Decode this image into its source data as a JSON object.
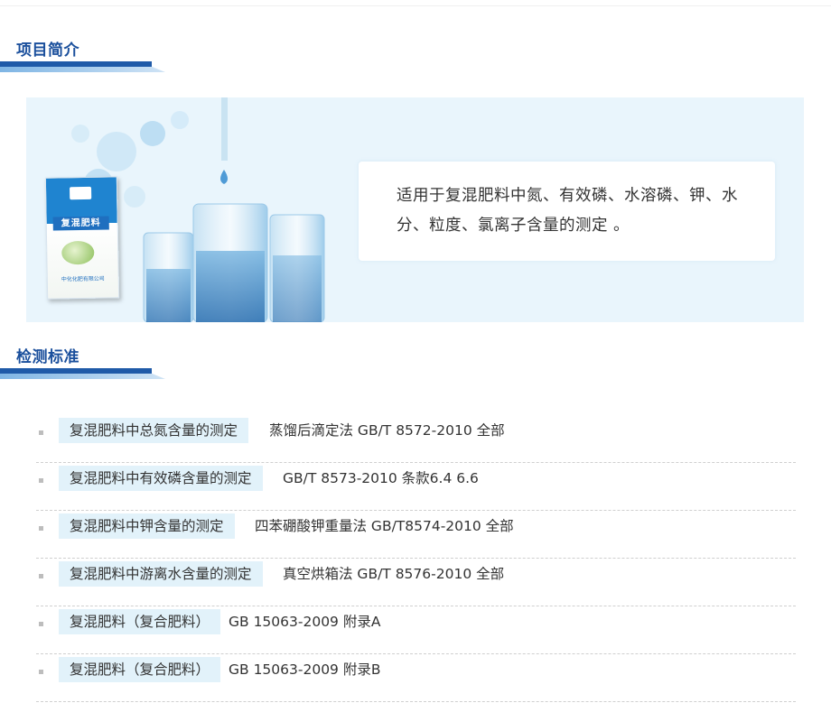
{
  "sections": {
    "intro_title": "项目简介",
    "standards_title": "检测标准"
  },
  "banner": {
    "description": "适用于复混肥料中氮、有效磷、水溶磷、钾、水分、粒度、氯离子含量的测定 。",
    "product_label": "复混肥料",
    "product_company": "中化化肥有限公司"
  },
  "standards": [
    {
      "item": "复混肥料中总氮含量的测定",
      "method": "蒸馏后滴定法 GB/T 8572-2010 全部"
    },
    {
      "item": "复混肥料中有效磷含量的测定",
      "method": "GB/T 8573-2010 条款6.4 6.6"
    },
    {
      "item": "复混肥料中钾含量的测定",
      "method": "四苯硼酸钾重量法 GB/T8574-2010 全部"
    },
    {
      "item": "复混肥料中游离水含量的测定",
      "method": "真空烘箱法 GB/T 8576-2010 全部"
    },
    {
      "item": "复混肥料（复合肥料）",
      "method": "GB 15063-2009 附录A"
    },
    {
      "item": "复混肥料（复合肥料）",
      "method": "GB 15063-2009 附录B"
    }
  ],
  "colors": {
    "accent": "#1a4f9c",
    "tag_bg": "#e2f2fa",
    "banner_bg": "#e9f5fc"
  }
}
